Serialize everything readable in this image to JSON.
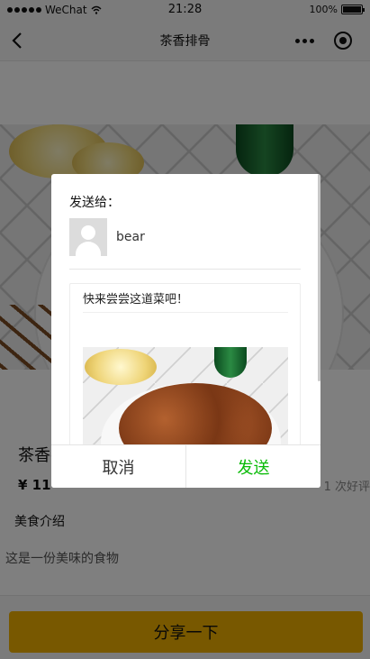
{
  "status_bar": {
    "carrier": "WeChat",
    "time": "21:28",
    "battery_percent": "100%"
  },
  "nav": {
    "title": "茶香排骨",
    "icons": [
      "back-arrow-icon",
      "more-dots-icon",
      "target-circle-icon"
    ]
  },
  "dish": {
    "name": "茶香排骨",
    "price": "¥ 11",
    "reviews": "1 次好评",
    "intro_title": "美食介绍",
    "intro_text": "这是一份美味的食物"
  },
  "share_button_label": "分享一下",
  "dialog": {
    "send_to_label": "发送给：",
    "recipient_name": "bear",
    "message": "快来尝尝这道菜吧！",
    "cancel_label": "取消",
    "send_label": "发送"
  },
  "colors": {
    "accent": "#f0b100",
    "send": "#09bb07"
  }
}
